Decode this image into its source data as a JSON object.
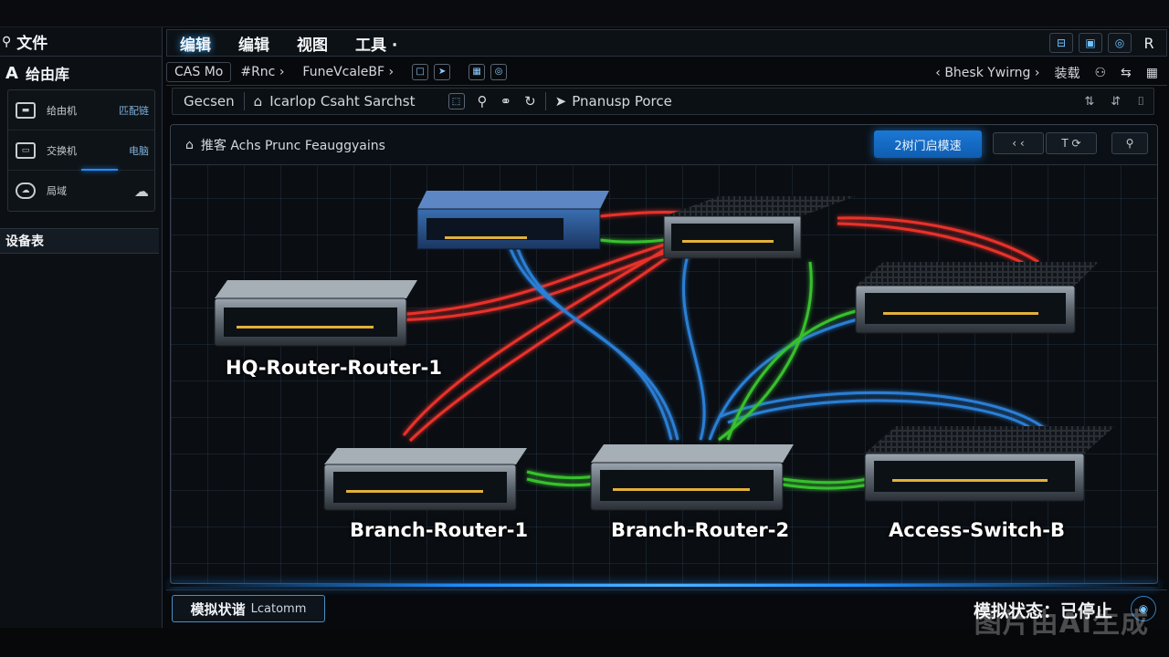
{
  "left_panel": {
    "file_menu": "文件",
    "library_title": "给由库",
    "library_items": [
      {
        "label": "给由机",
        "sub": "匹配链",
        "icon": "router-icon"
      },
      {
        "label": "交换机",
        "sub": "电脑",
        "icon": "switch-icon"
      },
      {
        "label": "局域",
        "sub": "",
        "icon": "cloud-icon"
      }
    ],
    "device_header": "设备表"
  },
  "menubar": {
    "items": [
      "编辑",
      "编辑",
      "视图",
      "工具 ·"
    ],
    "right_buttons": [
      "⊟",
      "▣",
      "◎",
      "R"
    ]
  },
  "toolbar1": {
    "left": [
      "CAS Mo",
      "#Rnc ›",
      "FuneVcaleBF ›"
    ],
    "right": [
      "‹ Bhesk Ywirng ›",
      "装载"
    ]
  },
  "toolbar2": {
    "first": "Gecsen",
    "second": "Icarlop Csaht Sarchst",
    "third": "Pnanusp Porce"
  },
  "canvas": {
    "breadcrumb": "推客 Achs Prunc Feauggyains",
    "simulate_button": "2树门启模速",
    "header_buttons": [
      "‹ ‹",
      "T ⟳",
      "⚲"
    ]
  },
  "nodes": [
    {
      "label": "HQ-Router-Router-1"
    },
    {
      "label": "Branch-Router-1"
    },
    {
      "label": "Branch-Router-2"
    },
    {
      "label": "Access-Switch-B"
    }
  ],
  "status": {
    "left_label": "模拟状谐",
    "left_sub": "Lcatomm",
    "right_label": "模拟状态：已停止"
  },
  "watermark": "图片由AI生成",
  "colors": {
    "accent": "#1f8fff",
    "cable_red": "#e8302c",
    "cable_blue": "#2c7fd6",
    "cable_green": "#39c02f",
    "background": "#0a0e13"
  }
}
